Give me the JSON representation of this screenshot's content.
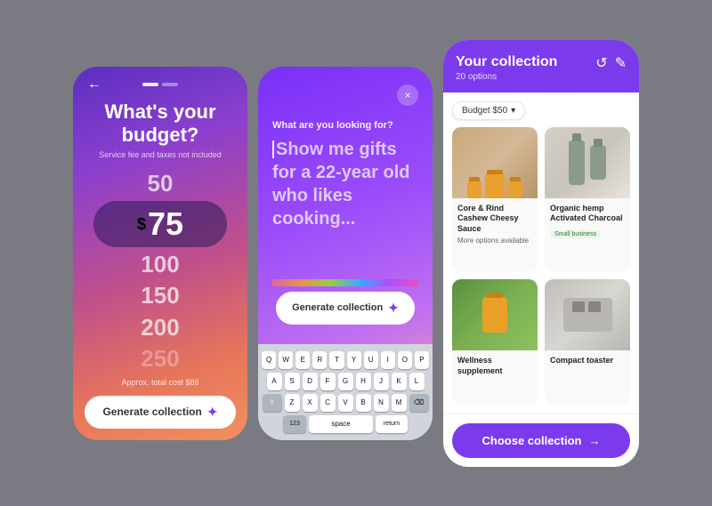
{
  "screen1": {
    "title": "What's your budget?",
    "subtitle": "Service fee and taxes not included",
    "back_label": "←",
    "selected_value": "75",
    "prefix": "$",
    "budget_items": [
      "50",
      "75",
      "100",
      "150",
      "200",
      "250"
    ],
    "approx_cost": "Approx. total cost $86",
    "generate_btn": "Generate collection"
  },
  "screen2": {
    "close_label": "×",
    "search_label": "What are you looking for?",
    "search_placeholder": "Show me gifts for a 22-year old who likes cooking...",
    "generate_btn": "Generate collection",
    "keyboard": {
      "row1": [
        "Q",
        "W",
        "E",
        "R",
        "T",
        "Y",
        "U",
        "I",
        "O",
        "P"
      ],
      "row2": [
        "A",
        "S",
        "D",
        "F",
        "G",
        "H",
        "J",
        "K",
        "L"
      ],
      "row3": [
        "Z",
        "X",
        "C",
        "V",
        "B",
        "N",
        "M"
      ],
      "bottom": [
        "123",
        "space",
        "return"
      ]
    }
  },
  "screen3": {
    "title": "Your collection",
    "subtitle": "20 options",
    "filter": {
      "label": "Budget $50",
      "chevron": "▾"
    },
    "products": [
      {
        "id": "cashew",
        "name": "Core & Rind Cashew Cheesy Sauce",
        "tag": "More options available",
        "badge": null
      },
      {
        "id": "charcoal",
        "name": "Organic hemp Activated Charcoal",
        "tag": null,
        "badge": "Small business"
      },
      {
        "id": "supplement",
        "name": "Wellness supplement",
        "tag": null,
        "badge": null
      },
      {
        "id": "toaster",
        "name": "Compact toaster",
        "tag": null,
        "badge": null
      }
    ],
    "choose_btn": "Choose collection",
    "icons": {
      "refresh": "↺",
      "edit": "✎"
    }
  }
}
